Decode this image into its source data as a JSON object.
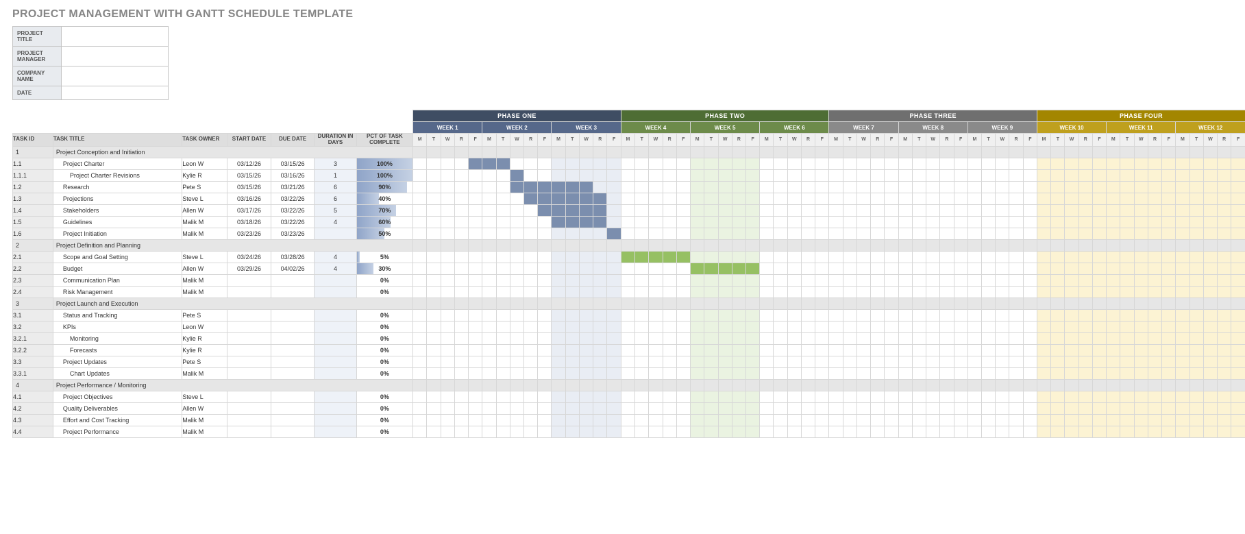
{
  "title": "PROJECT MANAGEMENT WITH GANTT SCHEDULE TEMPLATE",
  "meta": [
    {
      "l": "PROJECT TITLE",
      "v": ""
    },
    {
      "l": "PROJECT MANAGER",
      "v": ""
    },
    {
      "l": "COMPANY NAME",
      "v": ""
    },
    {
      "l": "DATE",
      "v": ""
    }
  ],
  "headers": {
    "task_id": "TASK ID",
    "task_title": "TASK TITLE",
    "owner": "TASK OWNER",
    "start": "START DATE",
    "due": "DUE DATE",
    "dur": "DURATION IN DAYS",
    "pct": "PCT OF TASK COMPLETE"
  },
  "phases": [
    {
      "name": "PHASE ONE",
      "cls": "1",
      "weeks": [
        "WEEK 1",
        "WEEK 2",
        "WEEK 3"
      ]
    },
    {
      "name": "PHASE TWO",
      "cls": "2",
      "weeks": [
        "WEEK 4",
        "WEEK 5",
        "WEEK 6"
      ]
    },
    {
      "name": "PHASE THREE",
      "cls": "3",
      "weeks": [
        "WEEK 7",
        "WEEK 8",
        "WEEK 9"
      ]
    },
    {
      "name": "PHASE FOUR",
      "cls": "4",
      "weeks": [
        "WEEK 10",
        "WEEK 11",
        "WEEK 12"
      ]
    }
  ],
  "days": [
    "M",
    "T",
    "W",
    "R",
    "F"
  ],
  "shaded_weeks": {
    "0": "1",
    "1": "1",
    "2": "1",
    "3": "2",
    "4": "2",
    "5": "2",
    "6": "3",
    "7": "3",
    "8": "3",
    "9": "4",
    "10": "4",
    "11": "4"
  },
  "shade_mask": [
    2,
    4,
    9,
    10,
    11
  ],
  "tasks": [
    {
      "sect": true,
      "id": "1",
      "title": "Project Conception and Initiation"
    },
    {
      "id": "1.1",
      "title": "Project Charter",
      "ind": 1,
      "own": "Leon W",
      "sd": "03/12/26",
      "dd": "03/15/26",
      "dur": "3",
      "pct": 100,
      "bar": [
        4,
        3,
        1
      ]
    },
    {
      "id": "1.1.1",
      "title": "Project Charter Revisions",
      "ind": 2,
      "own": "Kylie R",
      "sd": "03/15/26",
      "dd": "03/16/26",
      "dur": "1",
      "pct": 100,
      "bar": [
        7,
        1,
        1
      ]
    },
    {
      "id": "1.2",
      "title": "Research",
      "ind": 1,
      "own": "Pete S",
      "sd": "03/15/26",
      "dd": "03/21/26",
      "dur": "6",
      "pct": 90,
      "bar": [
        7,
        6,
        1
      ]
    },
    {
      "id": "1.3",
      "title": "Projections",
      "ind": 1,
      "own": "Steve L",
      "sd": "03/16/26",
      "dd": "03/22/26",
      "dur": "6",
      "pct": 40,
      "bar": [
        8,
        6,
        1
      ]
    },
    {
      "id": "1.4",
      "title": "Stakeholders",
      "ind": 1,
      "own": "Allen W",
      "sd": "03/17/26",
      "dd": "03/22/26",
      "dur": "5",
      "pct": 70,
      "bar": [
        9,
        5,
        1
      ]
    },
    {
      "id": "1.5",
      "title": "Guidelines",
      "ind": 1,
      "own": "Malik M",
      "sd": "03/18/26",
      "dd": "03/22/26",
      "dur": "4",
      "pct": 60,
      "bar": [
        10,
        4,
        1
      ]
    },
    {
      "id": "1.6",
      "title": "Project Initiation",
      "ind": 1,
      "own": "Malik M",
      "sd": "03/23/26",
      "dd": "03/23/26",
      "dur": "",
      "pct": 50,
      "bar": [
        14,
        1,
        1
      ]
    },
    {
      "sect": true,
      "id": "2",
      "title": "Project Definition and Planning"
    },
    {
      "id": "2.1",
      "title": "Scope and Goal Setting",
      "ind": 1,
      "own": "Steve L",
      "sd": "03/24/26",
      "dd": "03/28/26",
      "dur": "4",
      "pct": 5,
      "bar": [
        15,
        5,
        2
      ]
    },
    {
      "id": "2.2",
      "title": "Budget",
      "ind": 1,
      "own": "Allen W",
      "sd": "03/29/26",
      "dd": "04/02/26",
      "dur": "4",
      "pct": 30,
      "bar": [
        20,
        5,
        2
      ]
    },
    {
      "id": "2.3",
      "title": "Communication Plan",
      "ind": 1,
      "own": "Malik M",
      "sd": "",
      "dd": "",
      "dur": "",
      "pct": 0
    },
    {
      "id": "2.4",
      "title": "Risk Management",
      "ind": 1,
      "own": "Malik M",
      "sd": "",
      "dd": "",
      "dur": "",
      "pct": 0
    },
    {
      "sect": true,
      "id": "3",
      "title": "Project Launch and Execution"
    },
    {
      "id": "3.1",
      "title": "Status and Tracking",
      "ind": 1,
      "own": "Pete S",
      "sd": "",
      "dd": "",
      "dur": "",
      "pct": 0
    },
    {
      "id": "3.2",
      "title": "KPIs",
      "ind": 1,
      "own": "Leon W",
      "sd": "",
      "dd": "",
      "dur": "",
      "pct": 0
    },
    {
      "id": "3.2.1",
      "title": "Monitoring",
      "ind": 2,
      "own": "Kylie R",
      "sd": "",
      "dd": "",
      "dur": "",
      "pct": 0
    },
    {
      "id": "3.2.2",
      "title": "Forecasts",
      "ind": 2,
      "own": "Kylie R",
      "sd": "",
      "dd": "",
      "dur": "",
      "pct": 0
    },
    {
      "id": "3.3",
      "title": "Project Updates",
      "ind": 1,
      "own": "Pete S",
      "sd": "",
      "dd": "",
      "dur": "",
      "pct": 0
    },
    {
      "id": "3.3.1",
      "title": "Chart Updates",
      "ind": 2,
      "own": "Malik M",
      "sd": "",
      "dd": "",
      "dur": "",
      "pct": 0
    },
    {
      "sect": true,
      "id": "4",
      "title": "Project Performance / Monitoring"
    },
    {
      "id": "4.1",
      "title": "Project Objectives",
      "ind": 1,
      "own": "Steve L",
      "sd": "",
      "dd": "",
      "dur": "",
      "pct": 0
    },
    {
      "id": "4.2",
      "title": "Quality Deliverables",
      "ind": 1,
      "own": "Allen W",
      "sd": "",
      "dd": "",
      "dur": "",
      "pct": 0
    },
    {
      "id": "4.3",
      "title": "Effort and Cost Tracking",
      "ind": 1,
      "own": "Malik M",
      "sd": "",
      "dd": "",
      "dur": "",
      "pct": 0
    },
    {
      "id": "4.4",
      "title": "Project Performance",
      "ind": 1,
      "own": "Malik M",
      "sd": "",
      "dd": "",
      "dur": "",
      "pct": 0
    }
  ],
  "chart_data": {
    "type": "bar",
    "title": "Gantt schedule — task percent complete",
    "categories": [
      "1.1",
      "1.1.1",
      "1.2",
      "1.3",
      "1.4",
      "1.5",
      "1.6",
      "2.1",
      "2.2",
      "2.3",
      "2.4",
      "3.1",
      "3.2",
      "3.2.1",
      "3.2.2",
      "3.3",
      "3.3.1",
      "4.1",
      "4.2",
      "4.3",
      "4.4"
    ],
    "values": [
      100,
      100,
      90,
      40,
      70,
      60,
      50,
      5,
      30,
      0,
      0,
      0,
      0,
      0,
      0,
      0,
      0,
      0,
      0,
      0,
      0
    ],
    "xlabel": "Task ID",
    "ylabel": "% complete",
    "ylim": [
      0,
      100
    ]
  }
}
